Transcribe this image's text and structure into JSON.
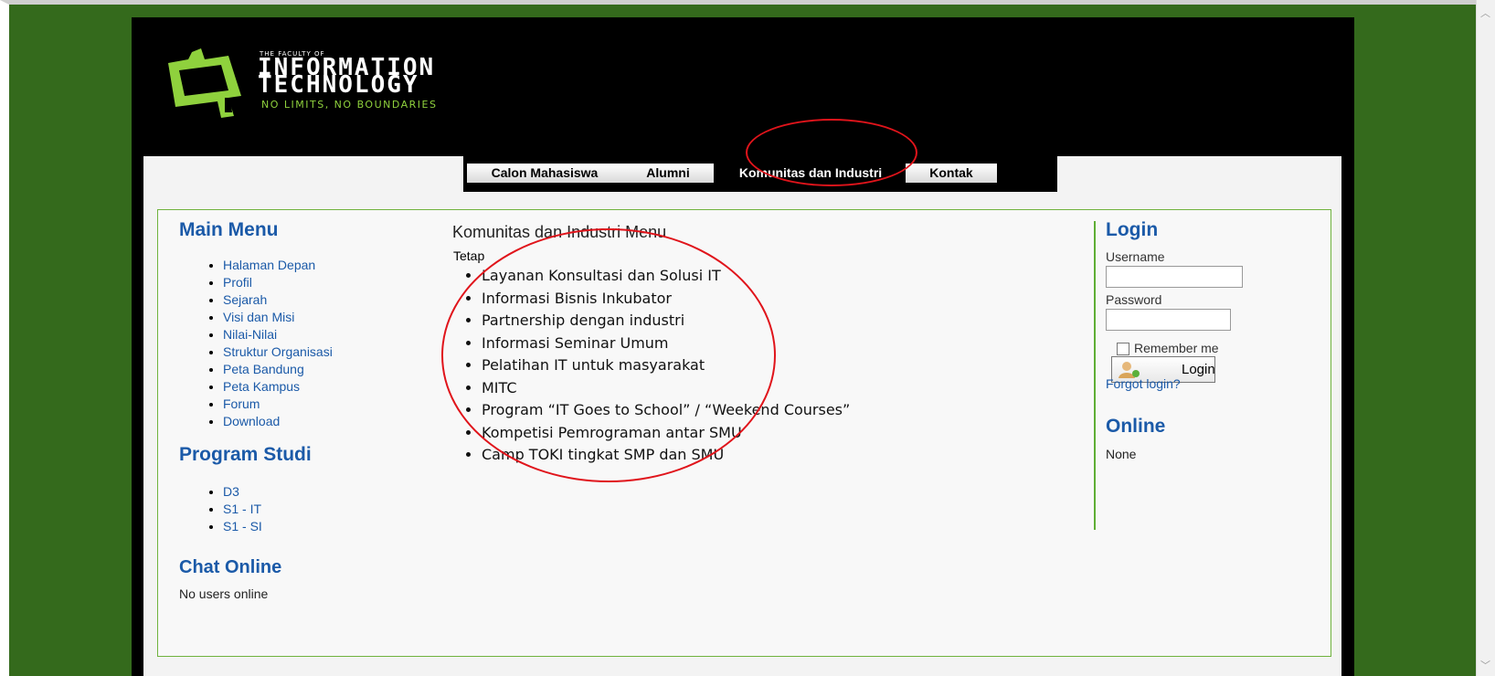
{
  "site": {
    "logo": {
      "small": "THE FACULTY OF",
      "line1": "INFORMATION",
      "line2": "TECHNOLOGY",
      "tagline": "NO LIMITS, NO BOUNDARIES"
    },
    "nav": [
      {
        "label": "Calon Mahasiswa",
        "active": false
      },
      {
        "label": "Alumni",
        "active": false
      },
      {
        "label": "Komunitas dan Industri",
        "active": true
      },
      {
        "label": "Kontak",
        "active": false
      }
    ]
  },
  "left": {
    "main_menu_title": "Main Menu",
    "main_menu": [
      "Halaman Depan",
      "Profil",
      "Sejarah",
      "Visi dan Misi",
      "Nilai-Nilai",
      "Struktur Organisasi",
      "Peta Bandung",
      "Peta Kampus",
      "Forum",
      "Download"
    ],
    "program_title": "Program Studi",
    "programs": [
      "D3",
      "S1 - IT",
      "S1 - SI"
    ],
    "chat_title": "Chat Online",
    "chat_status": "No users online"
  },
  "middle": {
    "title": "Komunitas dan Industri Menu",
    "subtitle": "Tetap",
    "items": [
      "Layanan Konsultasi dan Solusi IT",
      "Informasi Bisnis Inkubator",
      "Partnership dengan industri",
      "Informasi Seminar Umum",
      "Pelatihan IT untuk masyarakat",
      "MITC",
      " Program “IT Goes to School” / “Weekend Courses”",
      "Kompetisi Pemrograman antar SMU",
      "Camp TOKI tingkat SMP dan SMU"
    ]
  },
  "right": {
    "login_title": "Login",
    "username_label": "Username",
    "password_label": "Password",
    "remember_label": "Remember me",
    "login_button": "Login",
    "forgot_link": "Forgot login?",
    "online_title": "Online",
    "online_value": "None"
  },
  "colors": {
    "background_green": "#346a1c",
    "link_blue": "#1b5aa8",
    "accent_green": "#8fd13d",
    "annotation_red": "#e0141b"
  }
}
